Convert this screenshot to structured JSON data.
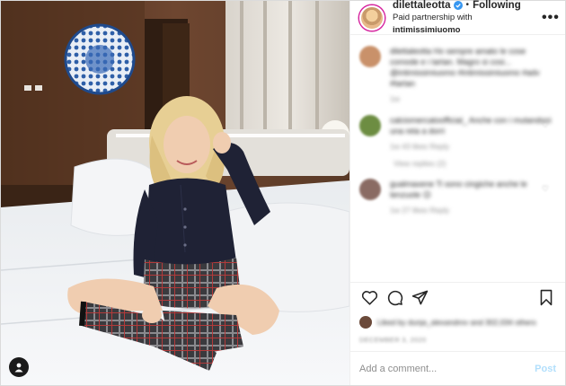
{
  "header": {
    "username": "dilettaleotta",
    "separator": "•",
    "following_label": "Following",
    "partnership_prefix": "Paid partnership with",
    "partnership_brand": "intimissimiuomo",
    "more_label": "•••"
  },
  "comments": [
    {
      "text": "dilettaleotta Ho sempre amato le cose comode e i tartan. Magro si cosi... @intimissimiuomo #intimissimiuomo #adv #tartan",
      "meta": "1w",
      "avatar_color": "#c9916a",
      "has_heart": false
    },
    {
      "text": "calciomercatoofficial_ Anche con i mutandoni una reta a dorri",
      "meta": "1w  43 likes  Reply",
      "avatar_color": "#6d8d42",
      "has_heart": true,
      "replies": "View replies (2)"
    },
    {
      "text": "gualmaxene Ti sono cingiche anche le tenzuole 😉",
      "meta": "1w  27 likes  Reply",
      "avatar_color": "#8a6b63",
      "has_heart": true
    }
  ],
  "likes": {
    "text": "Liked by dunja_alexandrov and 302,034 others"
  },
  "date": {
    "text": "DECEMBER 3, 2020"
  },
  "comment_box": {
    "placeholder": "Add a comment...",
    "post_label": "Post"
  },
  "icons": {
    "verified": "verified-badge-icon",
    "like": "heart-icon",
    "comment": "comment-icon",
    "share": "paper-plane-icon",
    "save": "bookmark-icon",
    "tag": "user-tag-icon"
  },
  "colors": {
    "verified_blue": "#3897f0",
    "post_button": "#b2dffc",
    "muted_text": "#8e8e8e",
    "story_ring": "#d6249f"
  }
}
